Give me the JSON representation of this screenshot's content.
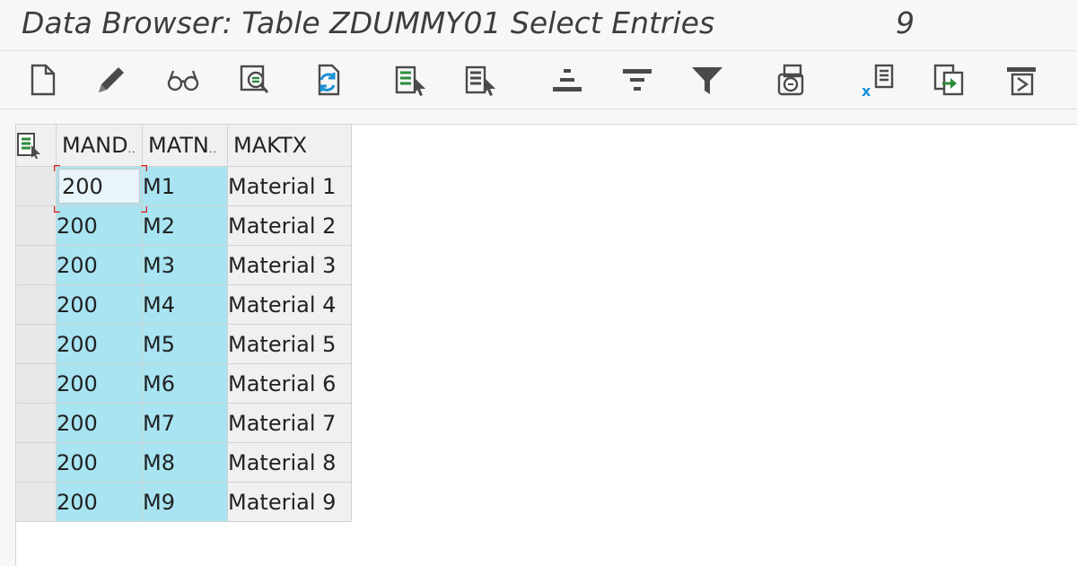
{
  "window": {
    "title": "Data Browser: Table ZDUMMY01 Select Entries",
    "entry_count": "9"
  },
  "toolbar": {
    "buttons": [
      {
        "name": "create-icon"
      },
      {
        "name": "change-icon"
      },
      {
        "name": "display-icon"
      },
      {
        "name": "check-table-icon"
      },
      {
        "name": "refresh-icon"
      },
      {
        "name": "select-all-icon"
      },
      {
        "name": "deselect-all-icon"
      },
      {
        "name": "sort-ascending-icon"
      },
      {
        "name": "sort-descending-icon"
      },
      {
        "name": "filter-icon"
      },
      {
        "name": "print-preview-icon"
      },
      {
        "name": "export-excel-icon"
      },
      {
        "name": "export-icon"
      },
      {
        "name": "layout-icon"
      }
    ]
  },
  "table": {
    "columns": [
      {
        "label": "MAND",
        "truncated": true
      },
      {
        "label": "MATN",
        "truncated": true
      },
      {
        "label": "MAKTX",
        "truncated": false
      }
    ],
    "rows": [
      {
        "mandt": "200",
        "matnr": "M1",
        "maktx": "Material 1"
      },
      {
        "mandt": "200",
        "matnr": "M2",
        "maktx": "Material 2"
      },
      {
        "mandt": "200",
        "matnr": "M3",
        "maktx": "Material 3"
      },
      {
        "mandt": "200",
        "matnr": "M4",
        "maktx": "Material 4"
      },
      {
        "mandt": "200",
        "matnr": "M5",
        "maktx": "Material 5"
      },
      {
        "mandt": "200",
        "matnr": "M6",
        "maktx": "Material 6"
      },
      {
        "mandt": "200",
        "matnr": "M7",
        "maktx": "Material 7"
      },
      {
        "mandt": "200",
        "matnr": "M8",
        "maktx": "Material 8"
      },
      {
        "mandt": "200",
        "matnr": "M9",
        "maktx": "Material 9"
      }
    ]
  },
  "colors": {
    "key_cell": "#a8e4f2",
    "value_cell": "#eef0f2",
    "focus_marker": "#e02020",
    "icon_gray": "#4a4a4a",
    "icon_green": "#2e8b3a",
    "icon_blue": "#1a8fd6"
  }
}
